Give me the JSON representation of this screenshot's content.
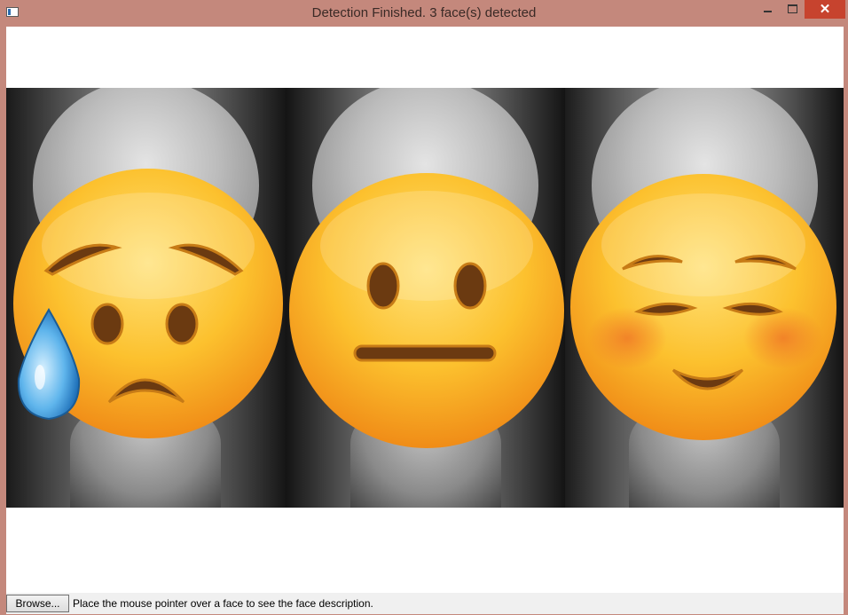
{
  "window": {
    "title": "Detection Finished. 3 face(s) detected",
    "close_glyph": "✕"
  },
  "faces": [
    {
      "emoji": "disappointed-relieved-face-icon",
      "expression": "sad with sweat drop"
    },
    {
      "emoji": "neutral-face-icon",
      "expression": "neutral"
    },
    {
      "emoji": "smiling-blushing-face-icon",
      "expression": "happy"
    }
  ],
  "statusbar": {
    "browse_label": "Browse...",
    "hint": "Place the mouse pointer over a face to see the face description."
  },
  "colors": {
    "window_frame": "#c4887c",
    "close_button": "#c7432e",
    "emoji_yellow": "#fbc02d"
  }
}
